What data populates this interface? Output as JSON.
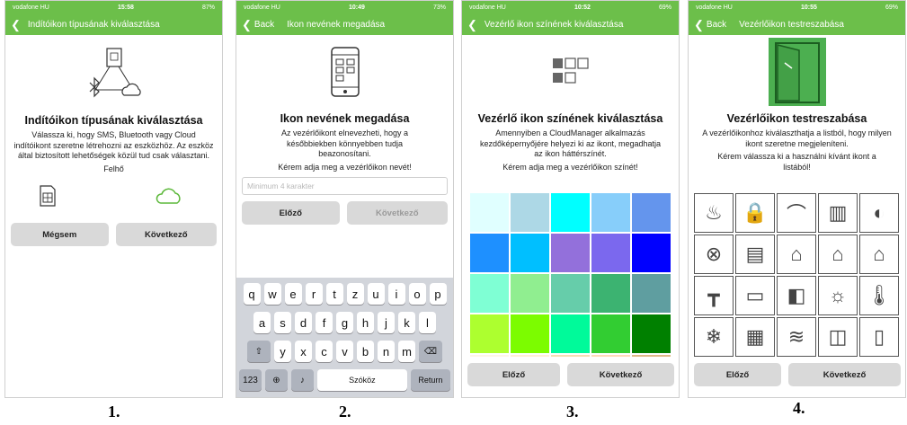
{
  "screens": [
    {
      "status": {
        "carrier": "vodafone HU",
        "time": "15:58",
        "battery": "87%"
      },
      "nav": {
        "back_label": "",
        "title": "Indítóikon típusának kiválasztása"
      },
      "headline": "Indítóikon típusának kiválasztása",
      "description": "Válassza ki, hogy SMS, Bluetooth vagy Cloud indítóikont szeretne létrehozni az eszközhöz. Az eszköz által biztosított lehetőségek közül tud csak választani.",
      "option_label": "Felhő",
      "cancel_label": "Mégsem",
      "next_label": "Következő",
      "caption": "1."
    },
    {
      "status": {
        "carrier": "vodafone HU",
        "time": "10:49",
        "battery": "73%"
      },
      "nav": {
        "back_label": "Back",
        "title": "Ikon nevének megadása"
      },
      "headline": "Ikon nevének megadása",
      "description": "Az vezérlőikont elnevezheti, hogy a későbbiekben könnyebben tudja beazonosítani.",
      "prompt": "Kérem adja meg a vezérlőikon nevét!",
      "input_placeholder": "Minimum 4 karakter",
      "prev_label": "Előző",
      "next_label": "Következő",
      "keyboard": {
        "row1": [
          "q",
          "w",
          "e",
          "r",
          "t",
          "z",
          "u",
          "i",
          "o",
          "p"
        ],
        "row2": [
          "a",
          "s",
          "d",
          "f",
          "g",
          "h",
          "j",
          "k",
          "l"
        ],
        "row3": [
          "y",
          "x",
          "c",
          "v",
          "b",
          "n",
          "m"
        ],
        "numbers_label": "123",
        "space_label": "Szóköz",
        "return_label": "Return"
      },
      "caption": "2."
    },
    {
      "status": {
        "carrier": "vodafone HU",
        "time": "10:52",
        "battery": "69%"
      },
      "nav": {
        "back_label": "",
        "title": "Vezérlő ikon színének kiválasztása"
      },
      "headline": "Vezérlő ikon színének kiválasztása",
      "description": "Amennyiben a CloudManager alkalmazás kezdőképernyőjére helyezi ki az ikont, megadhatja az ikon háttérszínét.",
      "prompt": "Kérem adja meg a vezérlőikon színét!",
      "colors": [
        "#e0ffff",
        "#add8e6",
        "#00ffff",
        "#87cefa",
        "#6495ed",
        "#1e90ff",
        "#00bfff",
        "#9370db",
        "#7b68ee",
        "#0000ff",
        "#7fffd4",
        "#90ee90",
        "#66cdaa",
        "#3cb371",
        "#5f9ea0",
        "#adff2f",
        "#7cfc00",
        "#00fa9a",
        "#32cd32",
        "#008000",
        "#fdf5e6",
        "#ffefd5",
        "#f5deb3",
        "#ffdab9",
        "#deb887"
      ],
      "prev_label": "Előző",
      "next_label": "Következő",
      "caption": "3."
    },
    {
      "status": {
        "carrier": "vodafone HU",
        "time": "10:55",
        "battery": "69%"
      },
      "nav": {
        "back_label": "Back",
        "title": "Vezérlőikon testreszabása"
      },
      "headline": "Vezérlőikon testreszabása",
      "description": "A vezérlőikonhoz kiválaszthatja a listból, hogy milyen ikont szeretne megjeleníteni.",
      "prompt": "Kérem válassza ki a használni kívánt ikont a listából!",
      "icons": [
        "sauna-icon",
        "padlock-icon",
        "padlock-arch-icon",
        "fence-gate-icon",
        "toggle-on-icon",
        "toggle-off-icon",
        "cabinet-icon",
        "garage-check-icon",
        "garage-x-icon",
        "garage-door-icon",
        "barrier-icon",
        "sliding-gate-icon",
        "sliding-door-icon",
        "light-bulb-icon",
        "thermometer-icon",
        "snowflake-icon",
        "heater-icon",
        "pool-icon",
        "window-icon",
        "door-icon"
      ],
      "prev_label": "Előző",
      "next_label": "Következő",
      "caption": "4."
    }
  ]
}
